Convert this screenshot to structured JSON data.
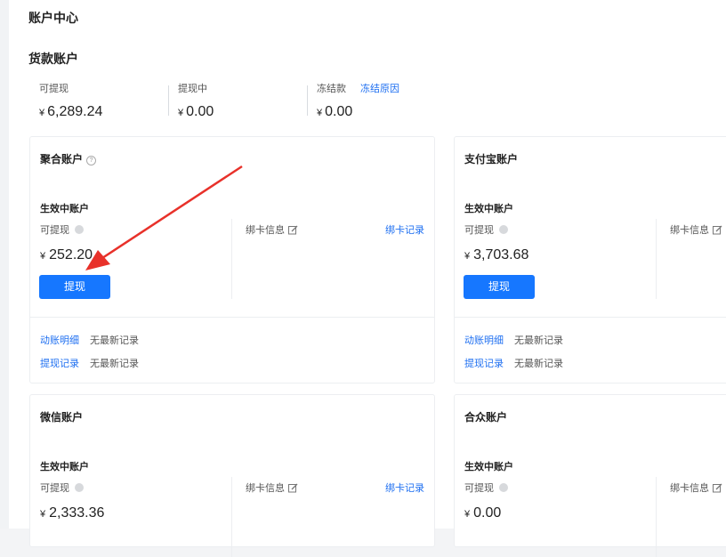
{
  "page_title": "账户中心",
  "section_title": "货款账户",
  "summary": {
    "currency": "¥",
    "withdrawable": {
      "label": "可提现",
      "value": "6,289.24"
    },
    "withdrawing": {
      "label": "提现中",
      "value": "0.00"
    },
    "frozen": {
      "label": "冻结款",
      "value": "0.00",
      "link": "冻结原因"
    }
  },
  "cards": {
    "juhe": {
      "title": "聚合账户",
      "sub_title": "生效中账户",
      "avail_label": "可提现",
      "amount": "252.20",
      "button": "提现",
      "bind_info": "绑卡信息",
      "bind_record": "绑卡记录",
      "records": [
        {
          "link": "动账明细",
          "status": "无最新记录"
        },
        {
          "link": "提现记录",
          "status": "无最新记录"
        }
      ]
    },
    "alipay": {
      "title": "支付宝账户",
      "sub_title": "生效中账户",
      "avail_label": "可提现",
      "amount": "3,703.68",
      "button": "提现",
      "bind_info": "绑卡信息",
      "records": [
        {
          "link": "动账明细",
          "status": "无最新记录"
        },
        {
          "link": "提现记录",
          "status": "无最新记录"
        }
      ]
    },
    "wechat": {
      "title": "微信账户",
      "sub_title": "生效中账户",
      "avail_label": "可提现",
      "amount": "2,333.36",
      "bind_info": "绑卡信息",
      "bind_record": "绑卡记录"
    },
    "hezhong": {
      "title": "合众账户",
      "sub_title": "生效中账户",
      "avail_label": "可提现",
      "amount": "0.00",
      "bind_info": "绑卡信息"
    }
  },
  "colors": {
    "accent": "#1677ff",
    "link": "#1e6ff1",
    "arrow": "#e8312a"
  }
}
